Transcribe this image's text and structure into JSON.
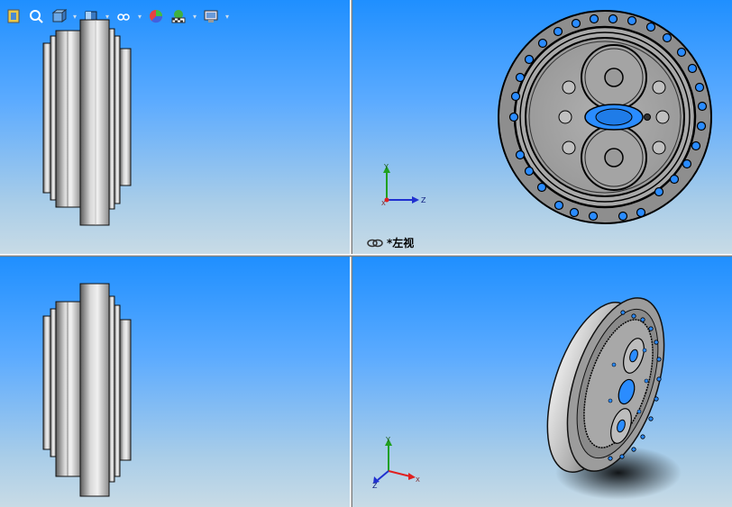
{
  "toolbar": {
    "icons": [
      "zoom-to-fit-icon",
      "zoom-area-icon",
      "previous-view-icon",
      "section-view-icon",
      "view-orientation-icon",
      "display-style-icon",
      "hide-show-items-icon",
      "edit-appearance-icon",
      "apply-scene-icon",
      "view-settings-icon"
    ]
  },
  "viewports": {
    "top_right": {
      "view_name": "*左视"
    },
    "top_right_triad": {
      "y": "Y",
      "z": "Z",
      "x": "X"
    },
    "bottom_right_triad": {
      "y": "Y",
      "z": "Z",
      "x": "X"
    }
  },
  "colors": {
    "viewport_top": "#1f8fff",
    "viewport_bottom": "#c8dbe6",
    "part_gray": "#b8b8b8",
    "axis_x": "#e02020",
    "axis_y": "#20a020",
    "axis_z": "#2030d0"
  }
}
